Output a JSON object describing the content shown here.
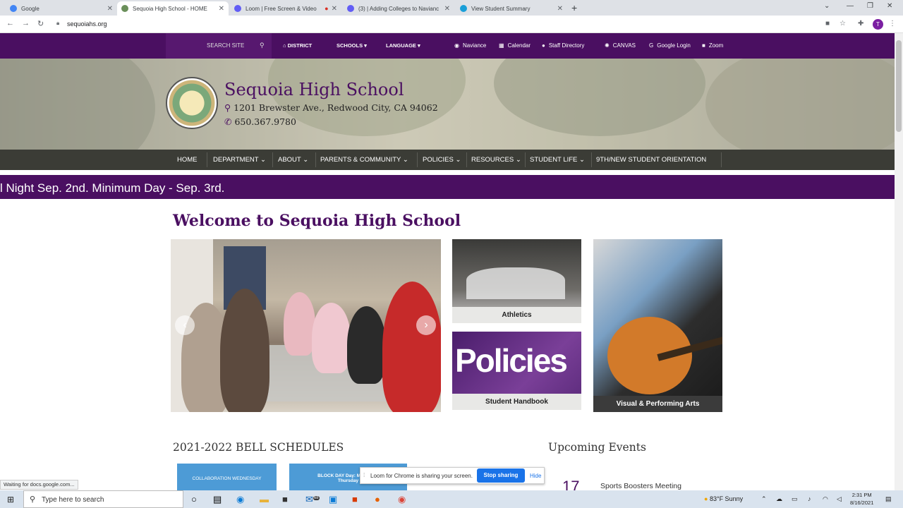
{
  "browser": {
    "tabs": [
      {
        "label": "Google",
        "active": false
      },
      {
        "label": "Sequoia High School - HOME",
        "active": true
      },
      {
        "label": "Loom | Free Screen & Video",
        "active": false
      },
      {
        "label": "(3) | Adding Colleges to Navianc",
        "active": false
      },
      {
        "label": "View Student Summary",
        "active": false
      }
    ],
    "new_tab": "+",
    "url": "sequoiahs.org",
    "profile_initial": "T"
  },
  "topbar": {
    "search_placeholder": "SEARCH SITE",
    "district": "DISTRICT",
    "schools": "SCHOOLS",
    "language": "LANGUAGE",
    "links": [
      "Naviance",
      "Calendar",
      "Staff Directory",
      "CANVAS",
      "Google Login",
      "Zoom"
    ]
  },
  "header": {
    "school_name": "Sequoia High School",
    "address": "1201 Brewster Ave., Redwood City, CA 94062",
    "phone": "650.367.9780"
  },
  "main_nav": [
    "HOME",
    "DEPARTMENT",
    "ABOUT",
    "PARENTS & COMMUNITY",
    "POLICIES",
    "RESOURCES",
    "STUDENT LIFE",
    "9TH/NEW STUDENT ORIENTATION"
  ],
  "ticker": "l Night Sep. 2nd. Minimum Day - Sep. 3rd.",
  "welcome_title": "Welcome to Sequoia High School",
  "tiles": {
    "athletics": "Athletics",
    "policies_word": "Policies",
    "handbook": "Student Handbook",
    "arts": "Visual & Performing Arts"
  },
  "bell_schedules_title": "2021-2022 BELL SCHEDULES",
  "bell_buttons": [
    "COLLABORATION WEDNESDAY",
    "BLOCK DAY Day: Monday & Thursday"
  ],
  "upcoming_events_title": "Upcoming Events",
  "event": {
    "day": "17",
    "name": "Sports Boosters Meeting"
  },
  "loom_bar": {
    "text": "Loom for Chrome is sharing your screen.",
    "stop": "Stop sharing",
    "hide": "Hide"
  },
  "status_text": "Waiting for docs.google.com...",
  "taskbar": {
    "search_placeholder": "Type here to search",
    "mail_badge": "68",
    "weather": "83°F  Sunny",
    "time": "2:31 PM",
    "date": "8/16/2021"
  },
  "colors": {
    "brand_purple": "#4a0f61",
    "nav_dark": "#3b3c36",
    "link_blue": "#1a73e8"
  }
}
